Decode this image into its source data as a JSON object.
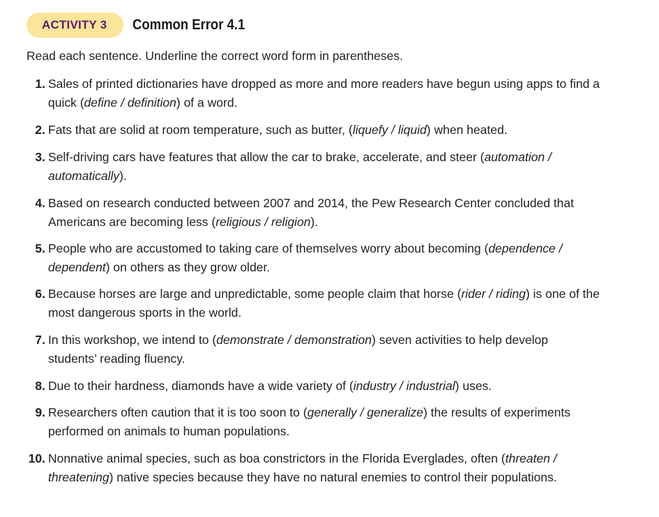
{
  "header": {
    "badge": "ACTIVITY 3",
    "title": "Common Error 4.1"
  },
  "instructions": "Read each sentence. Underline the correct word form in parentheses.",
  "items": [
    {
      "number": "1.",
      "lines": [
        [
          {
            "t": "Sales of printed dictionaries have dropped as more and more readers have begun using apps to find a"
          }
        ],
        [
          {
            "t": "quick ("
          },
          {
            "t": "define / definition",
            "i": true
          },
          {
            "t": ") of a word."
          }
        ]
      ]
    },
    {
      "number": "2.",
      "lines": [
        [
          {
            "t": "Fats that are solid at room temperature, such as butter, ("
          },
          {
            "t": "liquefy / liquid",
            "i": true
          },
          {
            "t": ") when heated."
          }
        ]
      ]
    },
    {
      "number": "3.",
      "lines": [
        [
          {
            "t": "Self-driving cars have features that allow the car to brake, accelerate, and steer ("
          },
          {
            "t": "automation /",
            "i": true
          }
        ],
        [
          {
            "t": "automatically",
            "i": true
          },
          {
            "t": ")."
          }
        ]
      ]
    },
    {
      "number": "4.",
      "lines": [
        [
          {
            "t": "Based on research conducted between 2007 and 2014, the Pew Research Center concluded that"
          }
        ],
        [
          {
            "t": "Americans are becoming less ("
          },
          {
            "t": "religious / religion",
            "i": true
          },
          {
            "t": ")."
          }
        ]
      ]
    },
    {
      "number": "5.",
      "lines": [
        [
          {
            "t": "People who are accustomed to taking care of themselves worry about becoming ("
          },
          {
            "t": "dependence /",
            "i": true
          }
        ],
        [
          {
            "t": "dependent",
            "i": true
          },
          {
            "t": ") on others as they grow older."
          }
        ]
      ]
    },
    {
      "number": "6.",
      "lines": [
        [
          {
            "t": "Because horses are large and unpredictable, some people claim that horse ("
          },
          {
            "t": "rider / riding",
            "i": true
          },
          {
            "t": ") is one of the"
          }
        ],
        [
          {
            "t": "most dangerous sports in the world."
          }
        ]
      ]
    },
    {
      "number": "7.",
      "lines": [
        [
          {
            "t": "In this workshop, we intend to ("
          },
          {
            "t": "demonstrate / demonstration",
            "i": true
          },
          {
            "t": ") seven activities to help develop"
          }
        ],
        [
          {
            "t": "students’ reading fluency."
          }
        ]
      ]
    },
    {
      "number": "8.",
      "lines": [
        [
          {
            "t": "Due to their hardness, diamonds have a wide variety of ("
          },
          {
            "t": "industry / industrial",
            "i": true
          },
          {
            "t": ") uses."
          }
        ]
      ]
    },
    {
      "number": "9.",
      "lines": [
        [
          {
            "t": "Researchers often caution that it is too soon to ("
          },
          {
            "t": "generally / generalize",
            "i": true
          },
          {
            "t": ") the results of experiments"
          }
        ],
        [
          {
            "t": "performed on animals to human populations."
          }
        ]
      ]
    },
    {
      "number": "10.",
      "lines": [
        [
          {
            "t": "Nonnative animal species, such as boa constrictors in the Florida Everglades, often ("
          },
          {
            "t": "threaten /",
            "i": true
          }
        ],
        [
          {
            "t": "threatening",
            "i": true
          },
          {
            "t": ") native species because they have no natural enemies to control their populations."
          }
        ]
      ]
    }
  ]
}
